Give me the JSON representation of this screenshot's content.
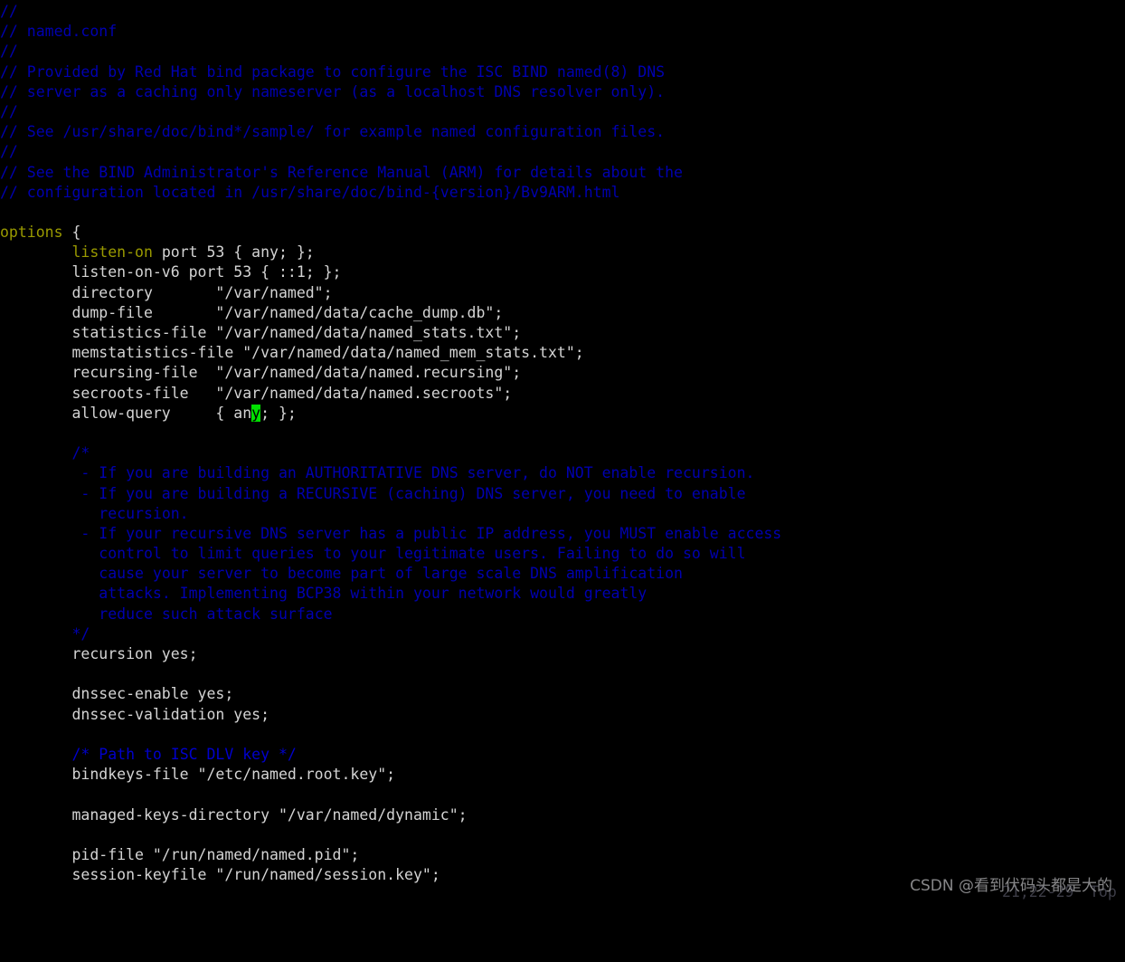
{
  "app": {
    "type": "terminal-text-editor",
    "editor": "vim",
    "filename": "named.conf",
    "background_color": "#000000",
    "foreground_color": "#d4d4d4",
    "comment_color": "#0000b0",
    "keyword_color": "#9a9a00",
    "cursor_color": "#00e000"
  },
  "statusline": {
    "ruler": "21,22-29",
    "file_position": "Top"
  },
  "watermark": {
    "text": "CSDN @看到伏码头都是大的"
  },
  "cursor": {
    "line": 21,
    "column": 22,
    "virtual_column": 29,
    "char_under_cursor": "y"
  },
  "buffer": {
    "lines": [
      {
        "n": 1,
        "segments": [
          {
            "t": "comment",
            "s": "//"
          }
        ]
      },
      {
        "n": 2,
        "segments": [
          {
            "t": "comment",
            "s": "// named.conf"
          }
        ]
      },
      {
        "n": 3,
        "segments": [
          {
            "t": "comment",
            "s": "//"
          }
        ]
      },
      {
        "n": 4,
        "segments": [
          {
            "t": "comment",
            "s": "// Provided by Red Hat bind package to configure the ISC BIND named(8) DNS"
          }
        ]
      },
      {
        "n": 5,
        "segments": [
          {
            "t": "comment",
            "s": "// server as a caching only nameserver (as a localhost DNS resolver only)."
          }
        ]
      },
      {
        "n": 6,
        "segments": [
          {
            "t": "comment",
            "s": "//"
          }
        ]
      },
      {
        "n": 7,
        "segments": [
          {
            "t": "comment",
            "s": "// See /usr/share/doc/bind*/sample/ for example named configuration files."
          }
        ]
      },
      {
        "n": 8,
        "segments": [
          {
            "t": "comment",
            "s": "//"
          }
        ]
      },
      {
        "n": 9,
        "segments": [
          {
            "t": "comment",
            "s": "// See the BIND Administrator's Reference Manual (ARM) for details about the"
          }
        ]
      },
      {
        "n": 10,
        "segments": [
          {
            "t": "comment",
            "s": "// configuration located in /usr/share/doc/bind-{version}/Bv9ARM.html"
          }
        ]
      },
      {
        "n": 11,
        "segments": [
          {
            "t": "plain",
            "s": ""
          }
        ]
      },
      {
        "n": 12,
        "segments": [
          {
            "t": "keyword",
            "s": "options"
          },
          {
            "t": "plain",
            "s": " {"
          }
        ]
      },
      {
        "n": 13,
        "segments": [
          {
            "t": "plain",
            "s": "        "
          },
          {
            "t": "keyword",
            "s": "listen-on"
          },
          {
            "t": "plain",
            "s": " port 53 { any; };"
          }
        ]
      },
      {
        "n": 14,
        "segments": [
          {
            "t": "plain",
            "s": "        listen-on-v6 port 53 { ::1; };"
          }
        ]
      },
      {
        "n": 15,
        "segments": [
          {
            "t": "plain",
            "s": "        directory       \"/var/named\";"
          }
        ]
      },
      {
        "n": 16,
        "segments": [
          {
            "t": "plain",
            "s": "        dump-file       \"/var/named/data/cache_dump.db\";"
          }
        ]
      },
      {
        "n": 17,
        "segments": [
          {
            "t": "plain",
            "s": "        statistics-file \"/var/named/data/named_stats.txt\";"
          }
        ]
      },
      {
        "n": 18,
        "segments": [
          {
            "t": "plain",
            "s": "        memstatistics-file \"/var/named/data/named_mem_stats.txt\";"
          }
        ]
      },
      {
        "n": 19,
        "segments": [
          {
            "t": "plain",
            "s": "        recursing-file  \"/var/named/data/named.recursing\";"
          }
        ]
      },
      {
        "n": 20,
        "segments": [
          {
            "t": "plain",
            "s": "        secroots-file   \"/var/named/data/named.secroots\";"
          }
        ]
      },
      {
        "n": 21,
        "segments": [
          {
            "t": "plain",
            "s": "        allow-query     { an"
          },
          {
            "t": "cursor",
            "s": "y"
          },
          {
            "t": "plain",
            "s": "; };"
          }
        ]
      },
      {
        "n": 22,
        "segments": [
          {
            "t": "plain",
            "s": ""
          }
        ]
      },
      {
        "n": 23,
        "segments": [
          {
            "t": "plain",
            "s": "        "
          },
          {
            "t": "comment",
            "s": "/*"
          }
        ]
      },
      {
        "n": 24,
        "segments": [
          {
            "t": "plain",
            "s": "         "
          },
          {
            "t": "comment",
            "s": "- If you are building an AUTHORITATIVE DNS server, do NOT enable recursion."
          }
        ]
      },
      {
        "n": 25,
        "segments": [
          {
            "t": "plain",
            "s": "         "
          },
          {
            "t": "comment",
            "s": "- If you are building a RECURSIVE (caching) DNS server, you need to enable"
          }
        ]
      },
      {
        "n": 26,
        "segments": [
          {
            "t": "plain",
            "s": "           "
          },
          {
            "t": "comment",
            "s": "recursion."
          }
        ]
      },
      {
        "n": 27,
        "segments": [
          {
            "t": "plain",
            "s": "         "
          },
          {
            "t": "comment",
            "s": "- If your recursive DNS server has a public IP address, you MUST enable access"
          }
        ]
      },
      {
        "n": 28,
        "segments": [
          {
            "t": "plain",
            "s": "           "
          },
          {
            "t": "comment",
            "s": "control to limit queries to your legitimate users. Failing to do so will"
          }
        ]
      },
      {
        "n": 29,
        "segments": [
          {
            "t": "plain",
            "s": "           "
          },
          {
            "t": "comment",
            "s": "cause your server to become part of large scale DNS amplification"
          }
        ]
      },
      {
        "n": 30,
        "segments": [
          {
            "t": "plain",
            "s": "           "
          },
          {
            "t": "comment",
            "s": "attacks. Implementing BCP38 within your network would greatly"
          }
        ]
      },
      {
        "n": 31,
        "segments": [
          {
            "t": "plain",
            "s": "           "
          },
          {
            "t": "comment",
            "s": "reduce such attack surface"
          }
        ]
      },
      {
        "n": 32,
        "segments": [
          {
            "t": "plain",
            "s": "        "
          },
          {
            "t": "comment",
            "s": "*/"
          }
        ]
      },
      {
        "n": 33,
        "segments": [
          {
            "t": "plain",
            "s": "        recursion yes;"
          }
        ]
      },
      {
        "n": 34,
        "segments": [
          {
            "t": "plain",
            "s": ""
          }
        ]
      },
      {
        "n": 35,
        "segments": [
          {
            "t": "plain",
            "s": "        dnssec-enable yes;"
          }
        ]
      },
      {
        "n": 36,
        "segments": [
          {
            "t": "plain",
            "s": "        dnssec-validation yes;"
          }
        ]
      },
      {
        "n": 37,
        "segments": [
          {
            "t": "plain",
            "s": ""
          }
        ]
      },
      {
        "n": 38,
        "segments": [
          {
            "t": "plain",
            "s": "        "
          },
          {
            "t": "comment-b",
            "s": "/* Path to ISC DLV key */"
          }
        ]
      },
      {
        "n": 39,
        "segments": [
          {
            "t": "plain",
            "s": "        bindkeys-file \"/etc/named.root.key\";"
          }
        ]
      },
      {
        "n": 40,
        "segments": [
          {
            "t": "plain",
            "s": ""
          }
        ]
      },
      {
        "n": 41,
        "segments": [
          {
            "t": "plain",
            "s": "        managed-keys-directory \"/var/named/dynamic\";"
          }
        ]
      },
      {
        "n": 42,
        "segments": [
          {
            "t": "plain",
            "s": ""
          }
        ]
      },
      {
        "n": 43,
        "segments": [
          {
            "t": "plain",
            "s": "        pid-file \"/run/named/named.pid\";"
          }
        ]
      },
      {
        "n": 44,
        "segments": [
          {
            "t": "plain",
            "s": "        session-keyfile \"/run/named/session.key\";"
          }
        ]
      }
    ]
  }
}
